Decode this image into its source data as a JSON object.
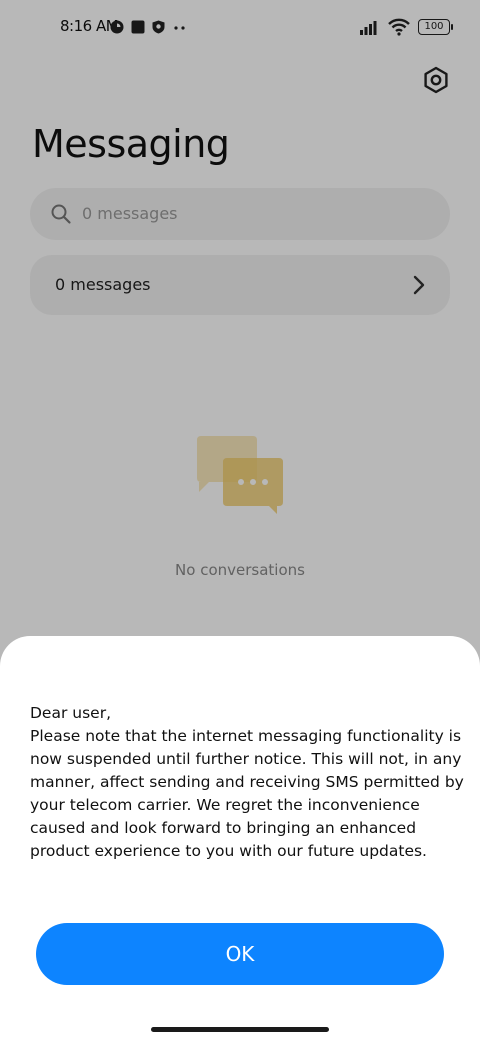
{
  "status_bar": {
    "time": "8:16 AM",
    "battery": "100",
    "icons": [
      "notification-icon",
      "app-square-icon",
      "shield-icon",
      "more-dots-icon",
      "signal-icon",
      "wifi-icon",
      "battery-icon"
    ]
  },
  "header": {
    "title": "Messaging",
    "settings_icon": "gear-icon"
  },
  "search": {
    "placeholder": "0 messages"
  },
  "messages_row": {
    "label": "0 messages"
  },
  "empty_state": {
    "text": "No conversations"
  },
  "dialog": {
    "body": "Dear user,\nPlease note that the internet messaging functionality is now suspended until further notice. This will not, in any manner, affect sending and receiving SMS permitted by your telecom carrier. We regret the inconvenience caused and look forward to bringing an enhanced product experience to you with our future updates.",
    "ok_label": "OK"
  },
  "colors": {
    "accent": "#0d84ff",
    "illustration": "#f0cc6a"
  }
}
